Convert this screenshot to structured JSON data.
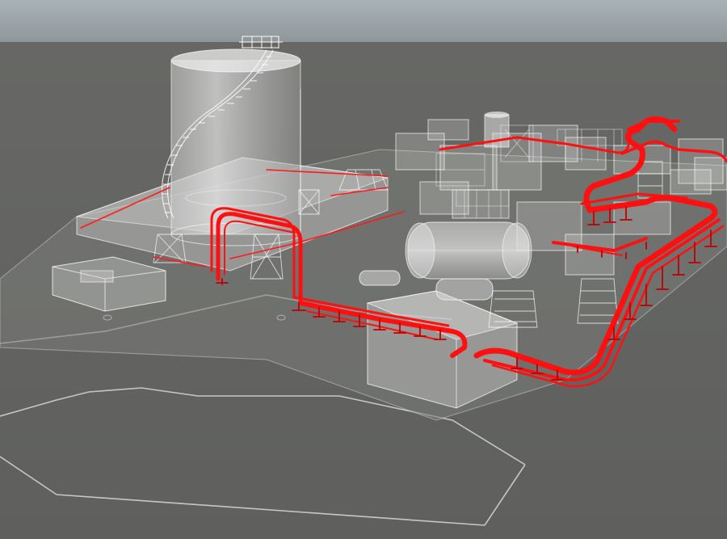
{
  "viewport": {
    "sky_top_color": "#a9b3b7",
    "sky_bottom_color": "#8d9598",
    "ground_color": "#5f605e",
    "ground_far_color": "#676865",
    "ghost_fill_color": "#e8e8e8",
    "ghost_stroke_color": "#f2f2f2",
    "highlight_color": "#ff1010",
    "highlight_dark_color": "#c00000"
  },
  "scene": {
    "highlighted_system": "pipe-rack-route",
    "transparency_mode": "x-ray",
    "objects": [
      "storage-tank",
      "tank-stairway",
      "tank-roof-platform",
      "tank-bund-wall",
      "control-building",
      "equipment-building",
      "horizontal-vessel",
      "heat-exchanger",
      "pipe-rack",
      "far-process-units",
      "small-tank-far"
    ]
  }
}
